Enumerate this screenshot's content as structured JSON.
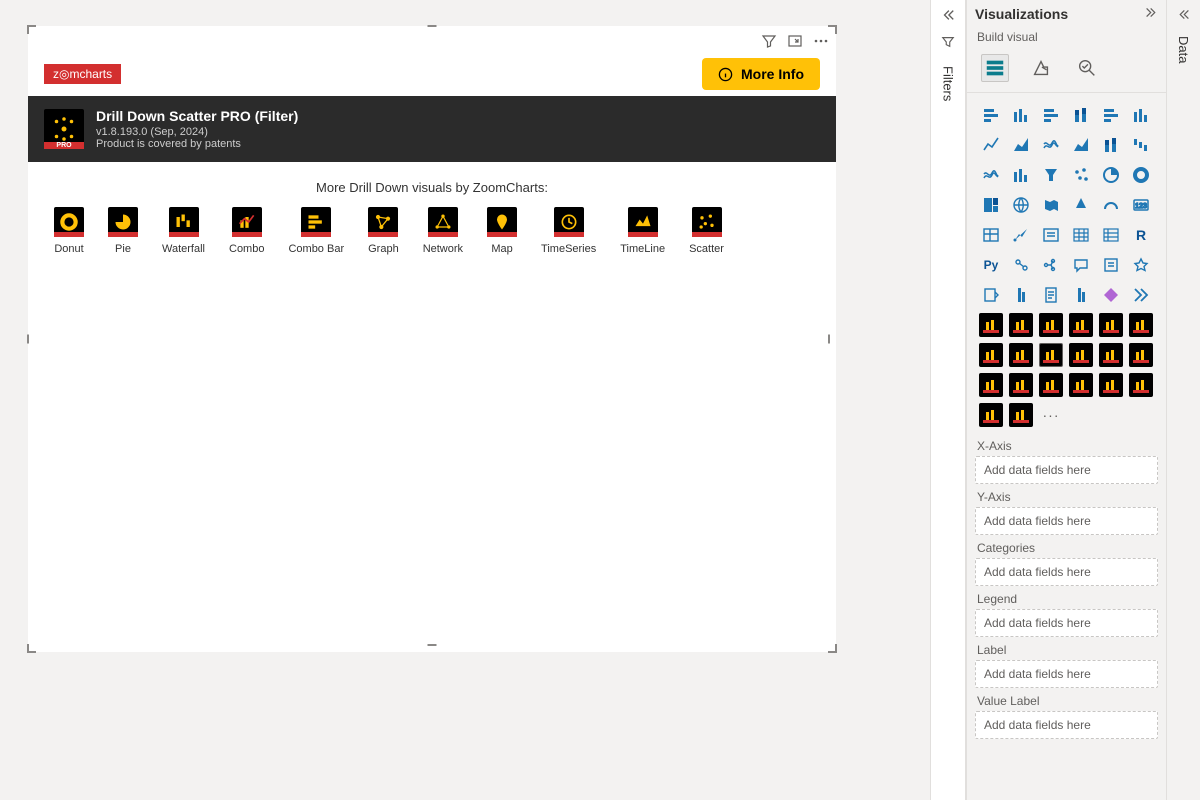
{
  "canvas": {
    "logo_text": "z◎mcharts",
    "more_info": "More Info",
    "title": "Drill Down Scatter PRO (Filter)",
    "version": "v1.8.193.0 (Sep, 2024)",
    "patent": "Product is covered by patents",
    "pro_badge": "PRO",
    "more_visuals_heading": "More Drill Down visuals by ZoomCharts:",
    "gallery": [
      {
        "label": "Donut"
      },
      {
        "label": "Pie"
      },
      {
        "label": "Waterfall"
      },
      {
        "label": "Combo"
      },
      {
        "label": "Combo Bar"
      },
      {
        "label": "Graph"
      },
      {
        "label": "Network"
      },
      {
        "label": "Map"
      },
      {
        "label": "TimeSeries"
      },
      {
        "label": "TimeLine"
      },
      {
        "label": "Scatter"
      }
    ]
  },
  "filters_pane": {
    "title": "Filters"
  },
  "viz_pane": {
    "title": "Visualizations",
    "subtitle": "Build visual",
    "r_label": "R",
    "py_label": "Py"
  },
  "fields": [
    {
      "label": "X-Axis",
      "placeholder": "Add data fields here"
    },
    {
      "label": "Y-Axis",
      "placeholder": "Add data fields here"
    },
    {
      "label": "Categories",
      "placeholder": "Add data fields here"
    },
    {
      "label": "Legend",
      "placeholder": "Add data fields here"
    },
    {
      "label": "Label",
      "placeholder": "Add data fields here"
    },
    {
      "label": "Value Label",
      "placeholder": "Add data fields here"
    }
  ],
  "data_pane": {
    "title": "Data"
  }
}
